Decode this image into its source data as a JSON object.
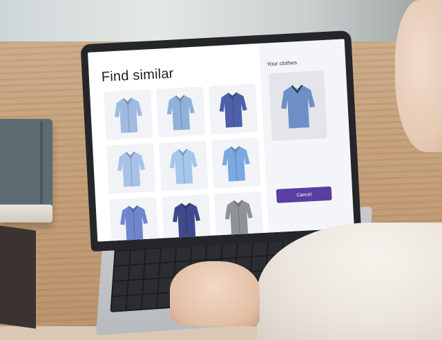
{
  "app": {
    "title": "Find similar",
    "sidebar_heading": "Your clothes",
    "cancel_label": "Cancel"
  },
  "results": [
    {
      "icon": "shirt-icon",
      "color": "#9fbbe0"
    },
    {
      "icon": "shirt-icon",
      "color": "#8fb0d8"
    },
    {
      "icon": "shirt-icon",
      "color": "#4d5fa8"
    },
    {
      "icon": "shirt-icon",
      "color": "#a8c2e8"
    },
    {
      "icon": "shirt-icon",
      "color": "#a6c6ea"
    },
    {
      "icon": "shirt-icon",
      "color": "#7aa8e0"
    },
    {
      "icon": "shirt-icon",
      "color": "#6f86cf"
    },
    {
      "icon": "shirt-icon",
      "color": "#3f4a8c"
    },
    {
      "icon": "shirt-icon",
      "color": "#8f9298"
    }
  ],
  "selected_item": {
    "icon": "shirt-icon",
    "color": "#6d8fc6"
  },
  "colors": {
    "accent": "#5b3fa0",
    "panel_background": "#f4f5f8"
  }
}
